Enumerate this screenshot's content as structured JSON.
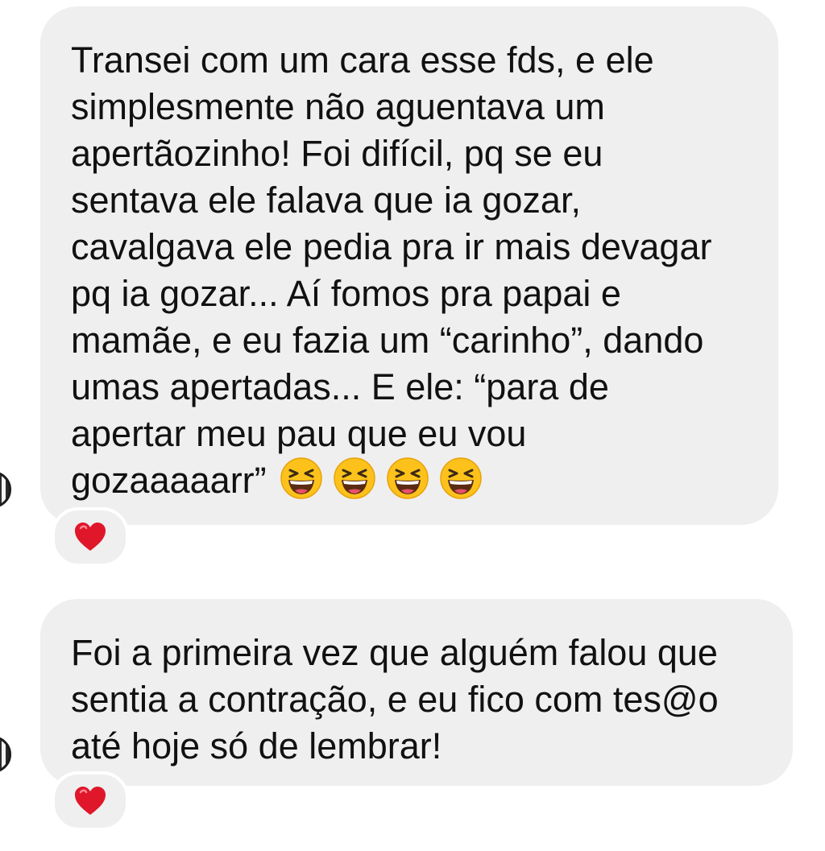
{
  "messages": [
    {
      "text": "Transei com um cara esse fds, e ele\nsimplesmente não aguentava um\napertãozinho! Foi difícil, pq se eu\nsentava ele falava que ia gozar,\ncavalgava ele pedia pra ir mais devagar\npq ia gozar... Aí fomos pra papai e\nmamãe, e eu fazia um “carinho”, dando\numas apertadas... E ele: “para de\napertar meu pau que eu vou\ngozaaaaarr”",
      "emojis": [
        "laughing-emoji",
        "laughing-emoji",
        "laughing-emoji",
        "laughing-emoji"
      ],
      "reaction": "heart-icon"
    },
    {
      "text": "Foi a primeira vez que alguém falou que\nsentia a contração, e eu fico com tes@o\naté hoje só de lembrar!",
      "reaction": "heart-icon"
    }
  ],
  "colors": {
    "bubble": "#efefef",
    "text": "#111111",
    "heart": "#e0162b",
    "emoji_face": "#fcc21b"
  }
}
